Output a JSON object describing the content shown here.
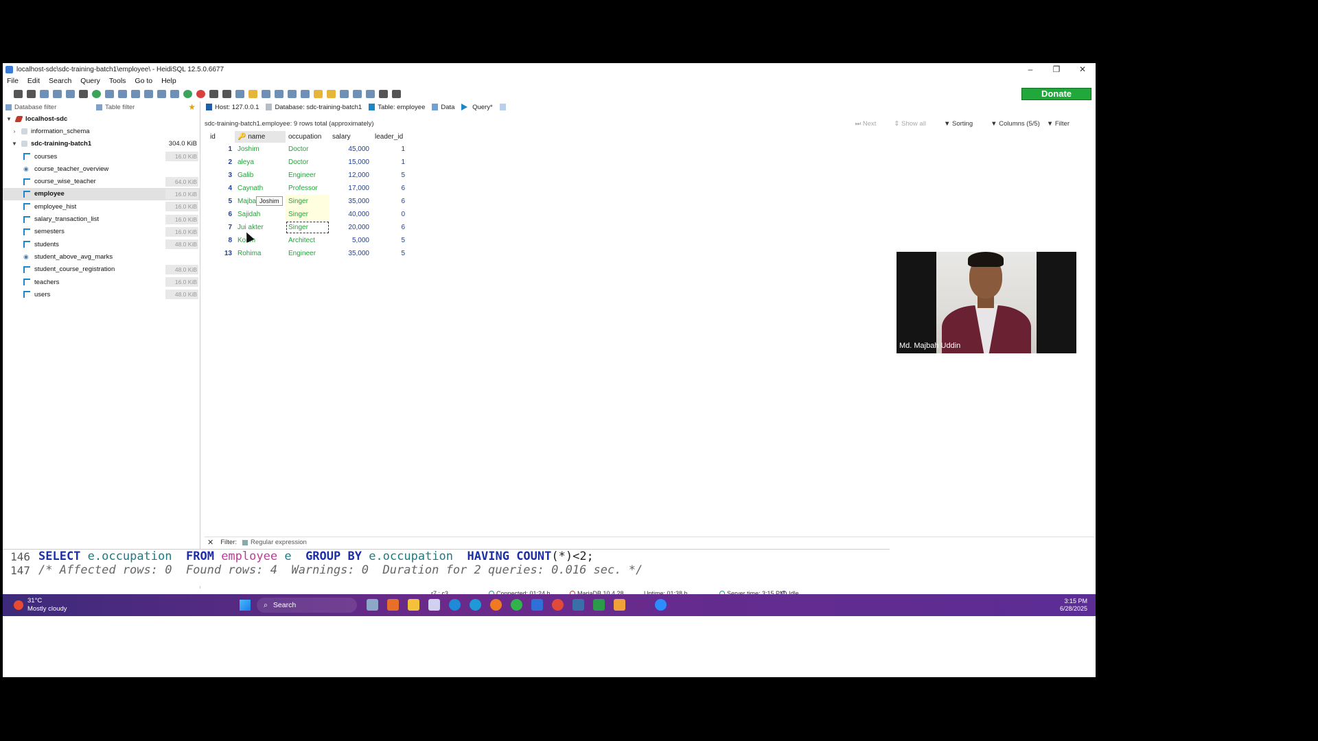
{
  "window": {
    "title": "localhost-sdc\\sdc-training-batch1\\employee\\ - HeidiSQL 12.5.0.6677",
    "controls": [
      "–",
      "❐",
      "✕"
    ]
  },
  "menu": [
    "File",
    "Edit",
    "Search",
    "Query",
    "Tools",
    "Go to",
    "Help"
  ],
  "toolbar": {
    "donate_label": "Donate"
  },
  "left_panel": {
    "db_filter_placeholder": "Database filter",
    "table_filter_placeholder": "Table filter",
    "tree": [
      {
        "label": "localhost-sdc",
        "level": 0,
        "kind": "host",
        "bold": true,
        "expanded": true,
        "size": ""
      },
      {
        "label": "information_schema",
        "level": 1,
        "kind": "db",
        "bold": false,
        "size": ""
      },
      {
        "label": "sdc-training-batch1",
        "level": 1,
        "kind": "db",
        "bold": true,
        "expanded": true,
        "size": "304.0 KiB"
      },
      {
        "label": "courses",
        "level": 2,
        "kind": "table",
        "size": "16.0 KiB"
      },
      {
        "label": "course_teacher_overview",
        "level": 2,
        "kind": "view",
        "size": ""
      },
      {
        "label": "course_wise_teacher",
        "level": 2,
        "kind": "table",
        "size": "64.0 KiB"
      },
      {
        "label": "employee",
        "level": 2,
        "kind": "table",
        "bold": true,
        "selected": true,
        "size": "16.0 KiB"
      },
      {
        "label": "employee_hist",
        "level": 2,
        "kind": "table",
        "size": "16.0 KiB"
      },
      {
        "label": "salary_transaction_list",
        "level": 2,
        "kind": "table",
        "size": "16.0 KiB"
      },
      {
        "label": "semesters",
        "level": 2,
        "kind": "table",
        "size": "16.0 KiB"
      },
      {
        "label": "students",
        "level": 2,
        "kind": "table",
        "size": "48.0 KiB"
      },
      {
        "label": "student_above_avg_marks",
        "level": 2,
        "kind": "view",
        "size": ""
      },
      {
        "label": "student_course_registration",
        "level": 2,
        "kind": "table",
        "size": "48.0 KiB"
      },
      {
        "label": "teachers",
        "level": 2,
        "kind": "table",
        "size": "16.0 KiB"
      },
      {
        "label": "users",
        "level": 2,
        "kind": "table",
        "size": "48.0 KiB"
      }
    ]
  },
  "tabs": {
    "host": "Host: 127.0.0.1",
    "database": "Database: sdc-training-batch1",
    "table": "Table: employee",
    "data": "Data",
    "query": "Query*"
  },
  "grid": {
    "info": "sdc-training-batch1.employee: 9 rows total (approximately)",
    "controls": {
      "next": "Next",
      "show_all": "Show all",
      "sorting": "Sorting",
      "columns": "Columns (5/5)",
      "filter": "Filter"
    },
    "columns": [
      "id",
      "name",
      "occupation",
      "salary",
      "leader_id"
    ],
    "rows": [
      [
        "1",
        "Joshim",
        "Doctor",
        "45,000",
        "1"
      ],
      [
        "2",
        "aleya",
        "Doctor",
        "15,000",
        "1"
      ],
      [
        "3",
        "Galib",
        "Engineer",
        "12,000",
        "5"
      ],
      [
        "4",
        "Caynath",
        "Professor",
        "17,000",
        "6"
      ],
      [
        "5",
        "Majbah Habib",
        "Singer",
        "35,000",
        "6"
      ],
      [
        "6",
        "Sajidah",
        "Singer",
        "40,000",
        "0"
      ],
      [
        "7",
        "Jui akter",
        "Singer",
        "20,000",
        "6"
      ],
      [
        "8",
        "Korim",
        "Architect",
        "5,000",
        "5"
      ],
      [
        "13",
        "Rohima",
        "Engineer",
        "35,000",
        "5"
      ]
    ],
    "tooltip": "Joshim"
  },
  "filter_bar": {
    "close": "✕",
    "label": "Filter:",
    "regex_label": "Regular expression"
  },
  "sql_log": {
    "line1_no": "146",
    "line2_no": "147",
    "l1": {
      "select": "SELECT",
      "col1": "e.occupation",
      "from": "FROM",
      "table": "employee",
      "alias": "e",
      "group": "GROUP BY",
      "col2": "e.occupation",
      "having": "HAVING",
      "count": "COUNT",
      "rest": "(*)<2;"
    },
    "l2": "/* Affected rows: 0  Found rows: 4  Warnings: 0  Duration for 2 queries: 0.016 sec. */"
  },
  "status_bar": {
    "cursor": "r7 : c3",
    "connected": "Connected: 01:24 h",
    "server": "MariaDB 10.4.28",
    "uptime": "Uptime: 01:38 h",
    "server_time": "Server time: 3:15 PM",
    "state": "Idle."
  },
  "taskbar": {
    "temp": "31°C",
    "weather": "Mostly cloudy",
    "search": "Search",
    "time": "3:15 PM",
    "date": "6/28/2025"
  },
  "webcam": {
    "name": "Md. Majbah Uddin"
  }
}
